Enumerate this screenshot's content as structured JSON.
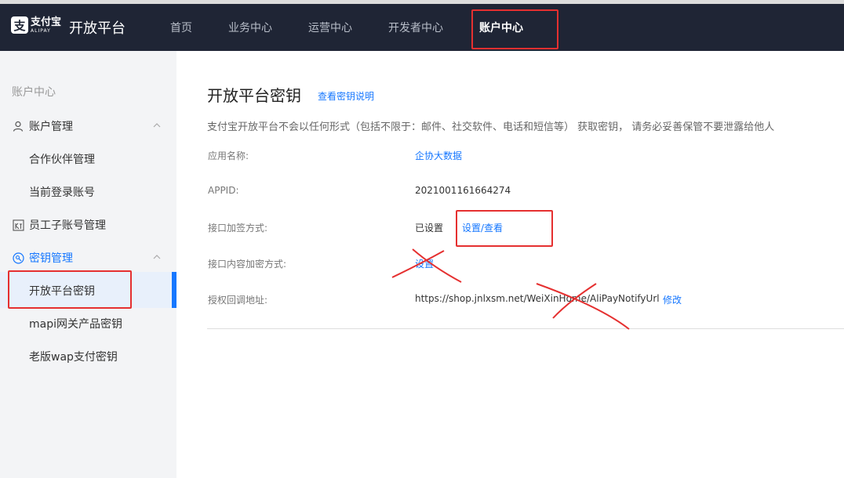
{
  "header": {
    "logo_cn": "支付宝",
    "logo_en": "ALIPAY",
    "platform": "开放平台",
    "nav": [
      "首页",
      "业务中心",
      "运营中心",
      "开发者中心",
      "账户中心"
    ]
  },
  "sidebar": {
    "section_title": "账户中心",
    "group_account": "账户管理",
    "item_partner": "合作伙伴管理",
    "item_current_login": "当前登录账号",
    "group_employee": "员工子账号管理",
    "group_keys": "密钥管理",
    "item_open_key": "开放平台密钥",
    "item_mapi_key": "mapi网关产品密钥",
    "item_wap_key": "老版wap支付密钥"
  },
  "main": {
    "title": "开放平台密钥",
    "title_link": "查看密钥说明",
    "notice": "支付宝开放平台不会以任何形式（包括不限于：邮件、社交软件、电话和短信等） 获取密钥， 请务必妥善保管不要泄露给他人",
    "rows": {
      "app_name_label": "应用名称:",
      "app_name_value": "企协大数据",
      "appid_label": "APPID:",
      "appid_value": "2021001161664274",
      "sign_label": "接口加签方式:",
      "sign_status": "已设置",
      "sign_link": "设置/查看",
      "encrypt_label": "接口内容加密方式:",
      "encrypt_link": "设置",
      "callback_label": "授权回调地址:",
      "callback_value": "https://shop.jnlxsm.net/WeiXinHome/AliPayNotifyUrl",
      "callback_link": "修改"
    }
  },
  "colors": {
    "header_bg": "#1f2535",
    "link": "#1677ff",
    "annotation": "#e53030"
  }
}
